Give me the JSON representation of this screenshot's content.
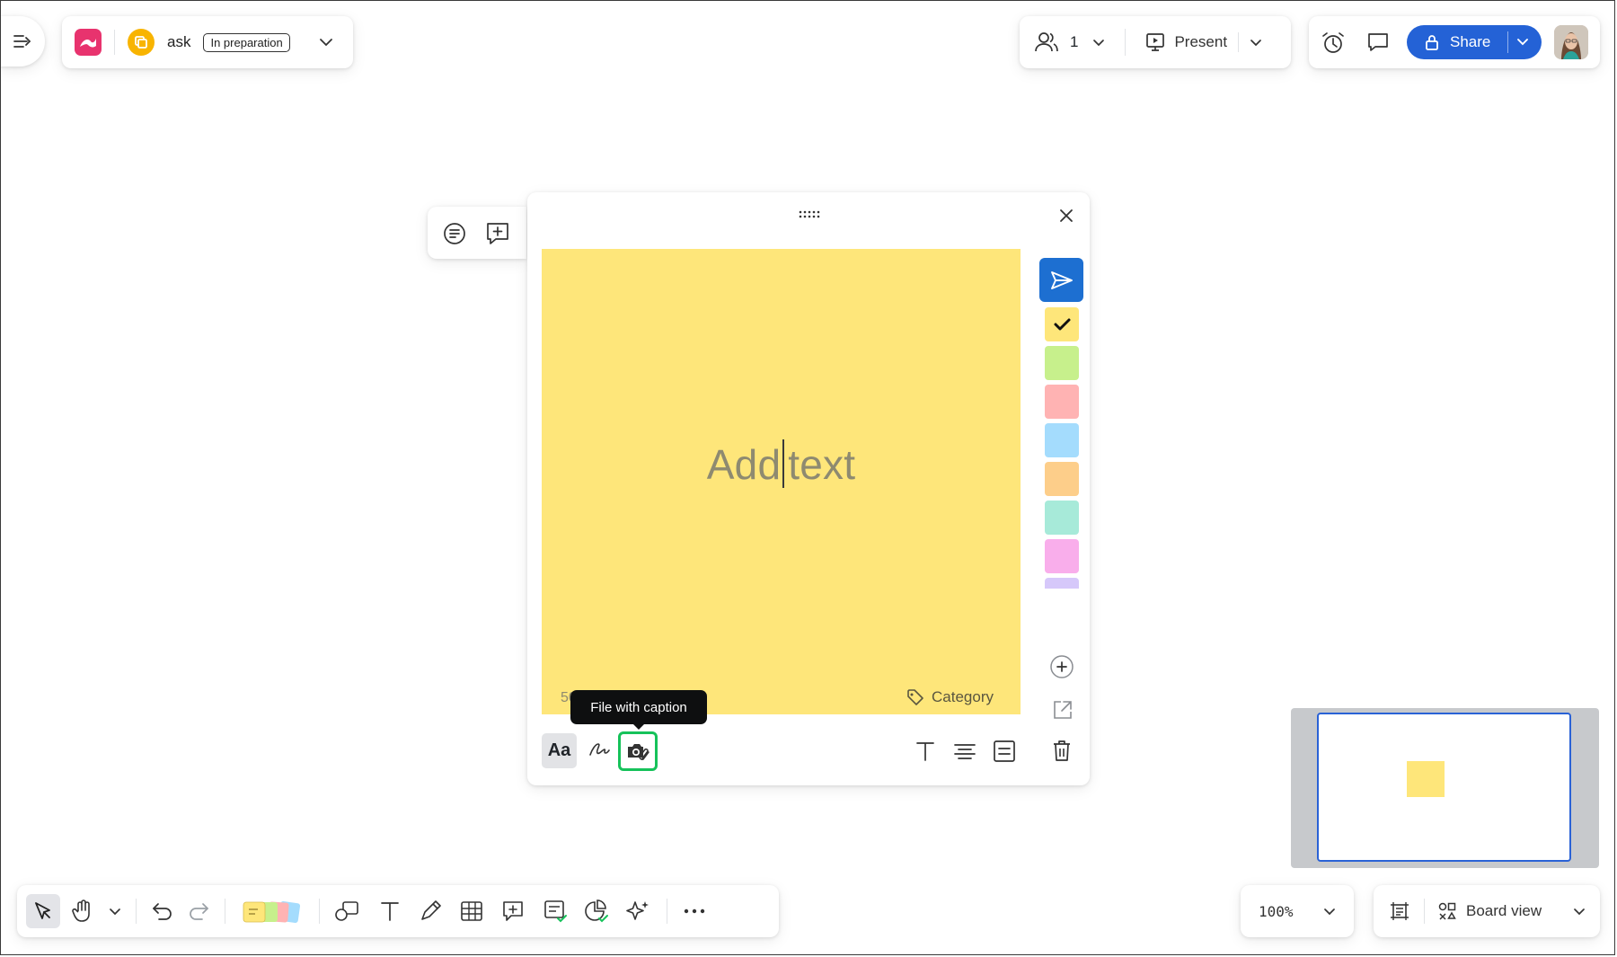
{
  "top_left": {
    "board_name": "ask",
    "status_badge": "In preparation"
  },
  "top_right": {
    "collaborators_count": "1",
    "present_label": "Present",
    "share_label": "Share"
  },
  "editor": {
    "placeholder": "Add text",
    "char_counter": "500",
    "category_label": "Category",
    "tooltip": "File with caption",
    "format_button_label": "Aa",
    "colors": [
      "#fee67a",
      "#c7f08c",
      "#ffb3b3",
      "#a4dcfd",
      "#fdce8a",
      "#a7ead9",
      "#f9aeeb",
      "#d6c8fa"
    ],
    "selected_color": "#fee67a"
  },
  "bottom": {
    "zoom_level": "100%",
    "view_label": "Board view"
  },
  "colors": {
    "accent": "#2462d6",
    "send": "#1d6fd1",
    "sticky": "#fee67a",
    "tooltip_highlight": "#16c25a"
  }
}
